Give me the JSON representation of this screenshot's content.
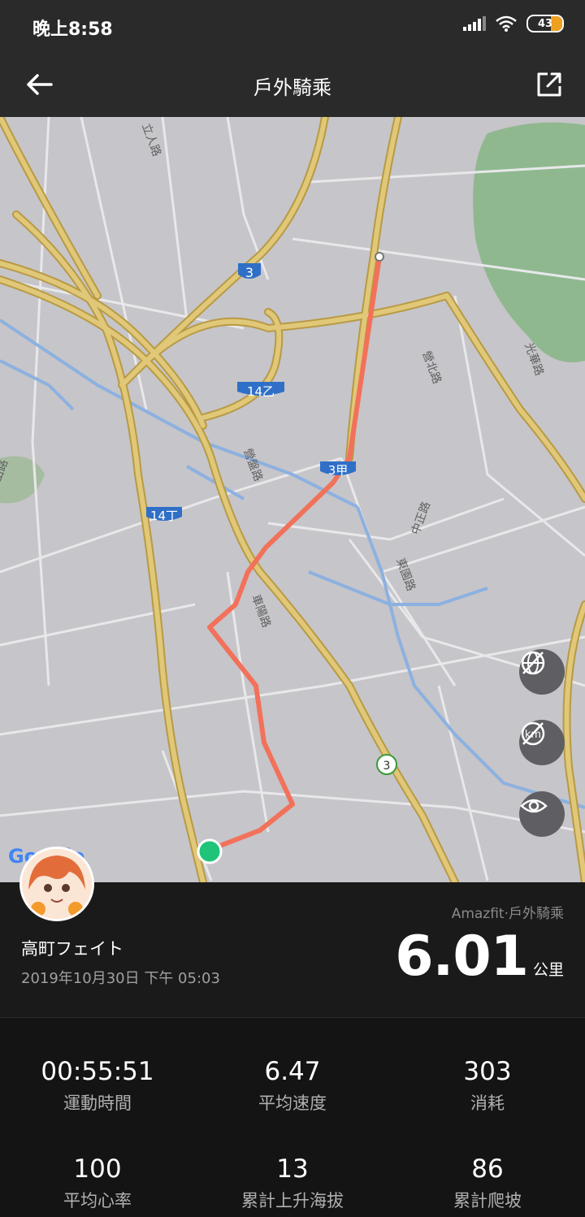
{
  "status_bar": {
    "time": "晚上8:58",
    "battery": "43"
  },
  "app_bar": {
    "title": "戶外騎乘",
    "back_icon": "arrow-left-icon",
    "share_icon": "share-external-icon"
  },
  "map": {
    "route_color": "#f2715a",
    "labels": {
      "road_3": "3",
      "road_14yi": "14乙",
      "road_3jia": "3甲",
      "road_14ding": "14丁",
      "road_3_flower": "3",
      "street_liren": "立人路",
      "street_yingbei": "營北路",
      "street_yingpan": "營盤路",
      "street_guanghua": "光華路",
      "street_zhongzheng": "中正路",
      "street_dongyuan": "東園路",
      "street_cheyang": "車陽路",
      "street_shan": "山路"
    },
    "google_logo": "Google",
    "controls": [
      "globe-off-icon",
      "km-off-icon",
      "eye-icon"
    ]
  },
  "summary": {
    "user_name": "高町フェイト",
    "date": "2019年10月30日 下午 05:03",
    "source": "Amazfit·戶外騎乘",
    "distance": "6.01",
    "distance_unit": "公里"
  },
  "stats": [
    {
      "value": "00:55:51",
      "label": "運動時間"
    },
    {
      "value": "6.47",
      "label": "平均速度"
    },
    {
      "value": "303",
      "label": "消耗"
    },
    {
      "value": "100",
      "label": "平均心率"
    },
    {
      "value": "13",
      "label": "累計上升海拔"
    },
    {
      "value": "86",
      "label": "累計爬坡"
    }
  ]
}
